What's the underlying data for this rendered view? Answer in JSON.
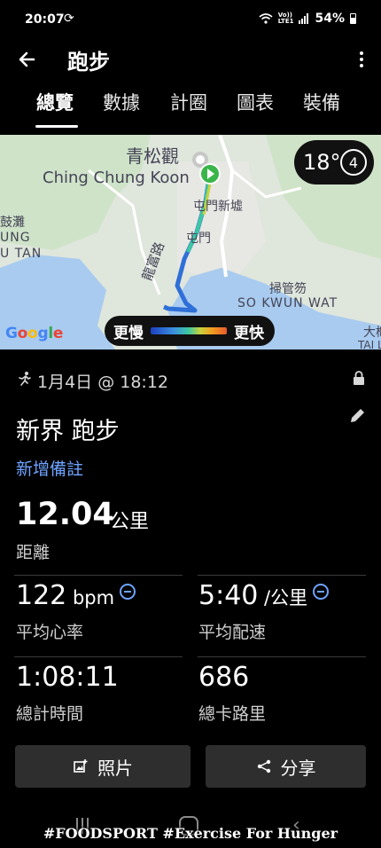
{
  "status_bar": {
    "time": "20:07",
    "sync_icon": "sync-icon",
    "network_label_top": "Vo))",
    "network_label_bottom": "LTE1",
    "battery": "54%"
  },
  "app_bar": {
    "title": "跑步"
  },
  "tabs": [
    {
      "label": "總覽",
      "active": true
    },
    {
      "label": "數據",
      "active": false
    },
    {
      "label": "計圈",
      "active": false
    },
    {
      "label": "圖表",
      "active": false
    },
    {
      "label": "裝備",
      "active": false
    }
  ],
  "map": {
    "place_labels": [
      "青松觀",
      "Ching Chung Koon",
      "屯門新墟",
      "屯門",
      "龍富路",
      "掃管笏",
      "SO KWUN WAT",
      "鼓灘",
      "UNG",
      "U TAN",
      "大槪",
      "TAI LA"
    ],
    "weather_temp": "18°",
    "weather_icon_text": "4",
    "pace_slower": "更慢",
    "pace_faster": "更快",
    "attribution": "Google",
    "colors": {
      "land": "#dfe6dc",
      "water": "#a9cbef",
      "route_green": "#3cc9a0",
      "route_blue": "#2f6fd8",
      "start_marker": "#3ab54a"
    }
  },
  "activity": {
    "date": "1月4日 @ 18:12",
    "name": "新界 跑步",
    "add_note": "新增備註",
    "distance": {
      "value": "12.04",
      "unit": "公里",
      "label": "距離"
    },
    "stats": [
      {
        "value": "122",
        "unit": " bpm",
        "label": "平均心率",
        "has_icon": true
      },
      {
        "value": "5:40",
        "unit": " /公里",
        "label": "平均配速",
        "has_icon": true
      },
      {
        "value": "1:08:11",
        "unit": "",
        "label": "總計時間",
        "has_icon": false
      },
      {
        "value": "686",
        "unit": "",
        "label": "總卡路里",
        "has_icon": false
      }
    ]
  },
  "buttons": {
    "photos": "照片",
    "share": "分享"
  },
  "watermark": "#FOODSPORT #Exercise For Hunger"
}
